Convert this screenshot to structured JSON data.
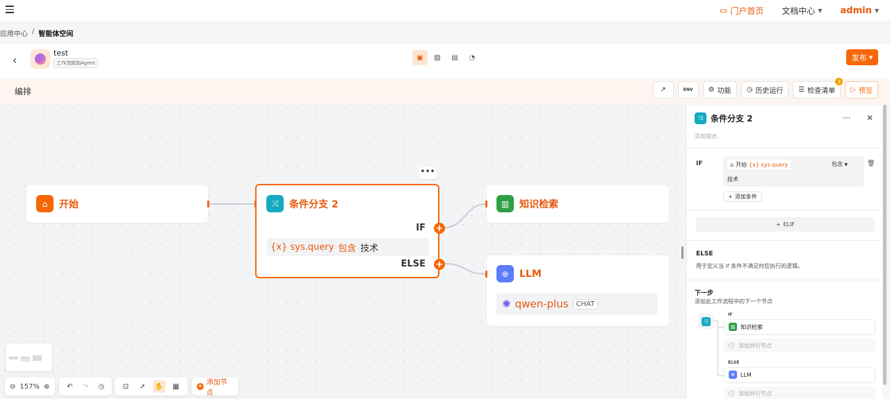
{
  "topbar": {
    "portal_label": "门户首页",
    "docs_label": "文档中心",
    "user": "admin"
  },
  "breadcrumb": {
    "parent": "应用中心",
    "separator": "/",
    "current": "智能体空间"
  },
  "app": {
    "name": "test",
    "tag": "工作流规划Agent",
    "publish_label": "发布"
  },
  "toolbar": {
    "title": "编排",
    "env_label": "ENV",
    "feature_label": "功能",
    "history_label": "历史运行",
    "checklist_label": "检查清单",
    "checklist_count": "3",
    "preview_label": "预览"
  },
  "canvas": {
    "start_node": {
      "title": "开始"
    },
    "condition_node": {
      "title": "条件分支 2",
      "more": "•••",
      "if_label": "IF",
      "else_label": "ELSE",
      "condition": {
        "variable": "{x} sys.query",
        "operator": "包含",
        "value": "技术"
      }
    },
    "knowledge_node": {
      "title": "知识检索"
    },
    "llm_node": {
      "title": "LLM",
      "model": "qwen-plus",
      "mode": "CHAT"
    }
  },
  "controls": {
    "zoom": "157%",
    "add_node_label": "添加节点"
  },
  "panel": {
    "title": "条件分支 2",
    "more": "···",
    "close": "✕",
    "description_placeholder": "添加描述...",
    "if_label": "IF",
    "condition": {
      "source": "开始",
      "variable": "{x} sys.query",
      "operator": "包含",
      "value": "技术"
    },
    "add_condition_label": "添加条件",
    "elif_label": "ELIF",
    "else_title": "ELSE",
    "else_desc": "用于定义当 if 条件不满足时应执行的逻辑。",
    "next_title": "下一步",
    "next_desc": "添加此工作流程中的下一个节点",
    "next_if_tag": "IF",
    "next_if_node": "知识检索",
    "next_else_tag": "ELSE",
    "next_else_node": "LLM",
    "add_parallel_label": "添加并行节点"
  },
  "colors": {
    "accent": "#f76707",
    "node_title": "#e8590c",
    "condition_icon": "#15aabf",
    "knowledge_icon": "#2f9e44",
    "llm_icon": "#5c7cfa"
  }
}
